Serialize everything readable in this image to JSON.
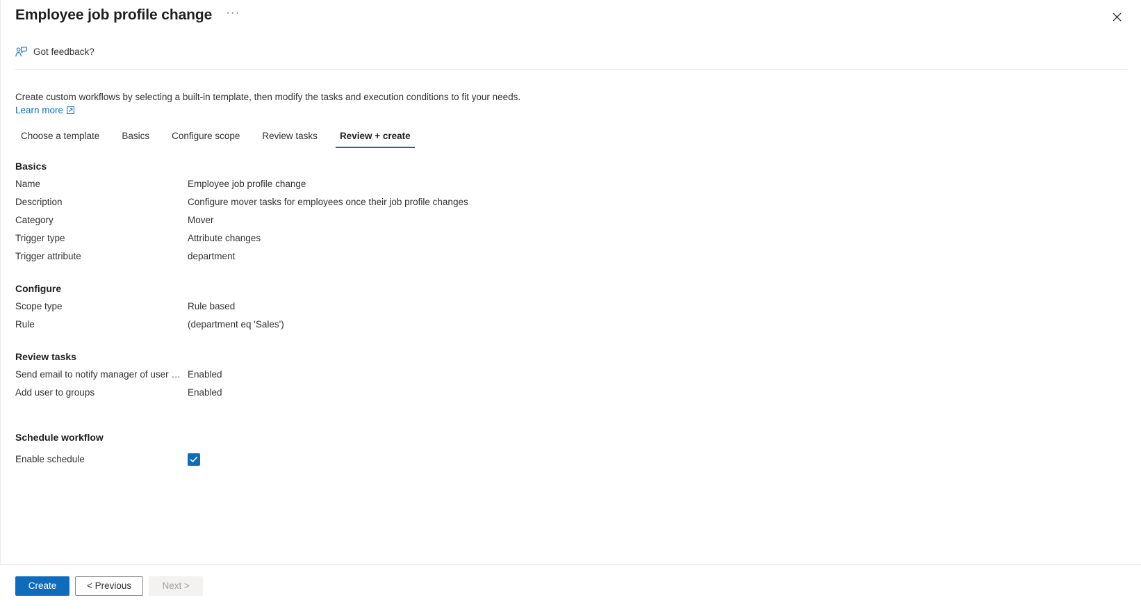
{
  "header": {
    "title": "Employee job profile change",
    "more_label": "···",
    "close_label": "✕",
    "feedback_label": "Got feedback?"
  },
  "intro": {
    "description": "Create custom workflows by selecting a built-in template, then modify the tasks and execution conditions to fit your needs.",
    "learn_more_label": "Learn more"
  },
  "tabs": [
    {
      "label": "Choose a template",
      "active": false
    },
    {
      "label": "Basics",
      "active": false
    },
    {
      "label": "Configure scope",
      "active": false
    },
    {
      "label": "Review tasks",
      "active": false
    },
    {
      "label": "Review + create",
      "active": true
    }
  ],
  "sections": {
    "basics": {
      "heading": "Basics",
      "rows": [
        {
          "key": "Name",
          "value": "Employee job profile change"
        },
        {
          "key": "Description",
          "value": "Configure mover tasks for employees once their job profile changes"
        },
        {
          "key": "Category",
          "value": "Mover"
        },
        {
          "key": "Trigger type",
          "value": "Attribute changes"
        },
        {
          "key": "Trigger attribute",
          "value": "department"
        }
      ]
    },
    "configure": {
      "heading": "Configure",
      "rows": [
        {
          "key": "Scope type",
          "value": "Rule based"
        },
        {
          "key": "Rule",
          "value": "(department eq 'Sales')"
        }
      ]
    },
    "review_tasks": {
      "heading": "Review tasks",
      "rows": [
        {
          "key": "Send email to notify manager of user mo…",
          "value": "Enabled"
        },
        {
          "key": "Add user to groups",
          "value": "Enabled"
        }
      ]
    },
    "schedule": {
      "heading": "Schedule workflow",
      "enable_schedule_label": "Enable schedule",
      "enable_schedule_checked": true
    }
  },
  "footer": {
    "create_label": "Create",
    "previous_label": "< Previous",
    "next_label": "Next >"
  },
  "colors": {
    "accent": "#0f6cbd",
    "link": "#0f6cbd",
    "text": "#323130",
    "heading": "#201f1e",
    "divider": "#e1dfdd",
    "disabled_bg": "#f3f2f1",
    "disabled_text": "#a19f9d"
  }
}
